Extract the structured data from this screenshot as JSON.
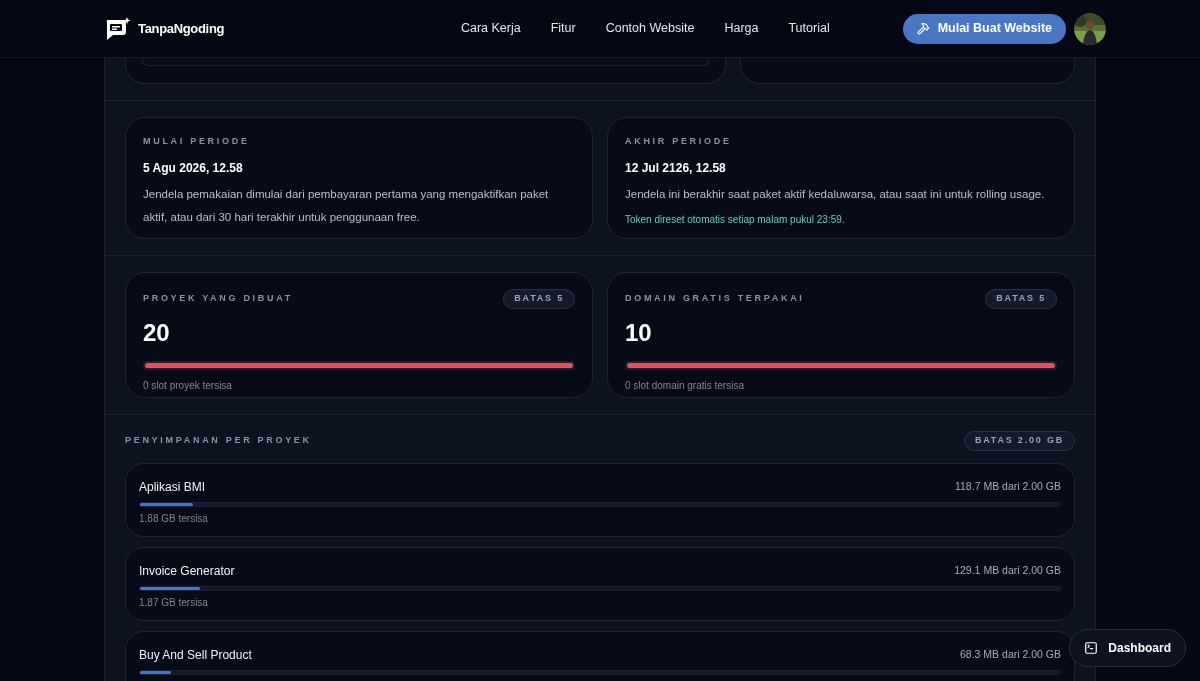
{
  "header": {
    "logo": "TanpaNgoding",
    "nav": [
      "Cara Kerja",
      "Fitur",
      "Contoh Website",
      "Harga",
      "Tutorial"
    ],
    "cta": "Mulai Buat Website"
  },
  "period": [
    {
      "label": "MULAI PERIODE",
      "value": "5 Agu 2026, 12.58",
      "description": "Jendela pemakaian dimulai dari pembayaran pertama yang mengaktifkan paket aktif, atau dari 30 hari terakhir untuk penggunaan free."
    },
    {
      "label": "AKHIR PERIODE",
      "value": "12 Jul 2126, 12.58",
      "description": "Jendela ini berakhir saat paket aktif kedaluwarsa, atau saat ini untuk rolling usage.",
      "note": "Token direset otomatis setiap malam pukul 23:59."
    }
  ],
  "quotas": [
    {
      "label": "PROYEK YANG DIBUAT",
      "limit": "BATAS 5",
      "value": "20",
      "level": 1,
      "remaining": "0 slot proyek tersisa"
    },
    {
      "label": "DOMAIN GRATIS TERPAKAI",
      "limit": "BATAS 5",
      "value": "10",
      "level": 1,
      "remaining": "0 slot domain gratis tersisa"
    }
  ],
  "storage": {
    "title": "PENYIMPANAN PER PROYEK",
    "limit": "BATAS 2.00 GB",
    "projects": [
      {
        "name": "Aplikasi BMI",
        "usage": "118.7 MB dari 2.00 GB",
        "level": 0.058,
        "remaining": "1.88 GB tersisa"
      },
      {
        "name": "Invoice Generator",
        "usage": "129.1 MB dari 2.00 GB",
        "level": 0.065,
        "remaining": "1.87 GB tersisa"
      },
      {
        "name": "Buy And Sell Product",
        "usage": "68.3 MB dari 2.00 GB",
        "level": 0.034
      }
    ]
  },
  "floating_button": "Dashboard"
}
